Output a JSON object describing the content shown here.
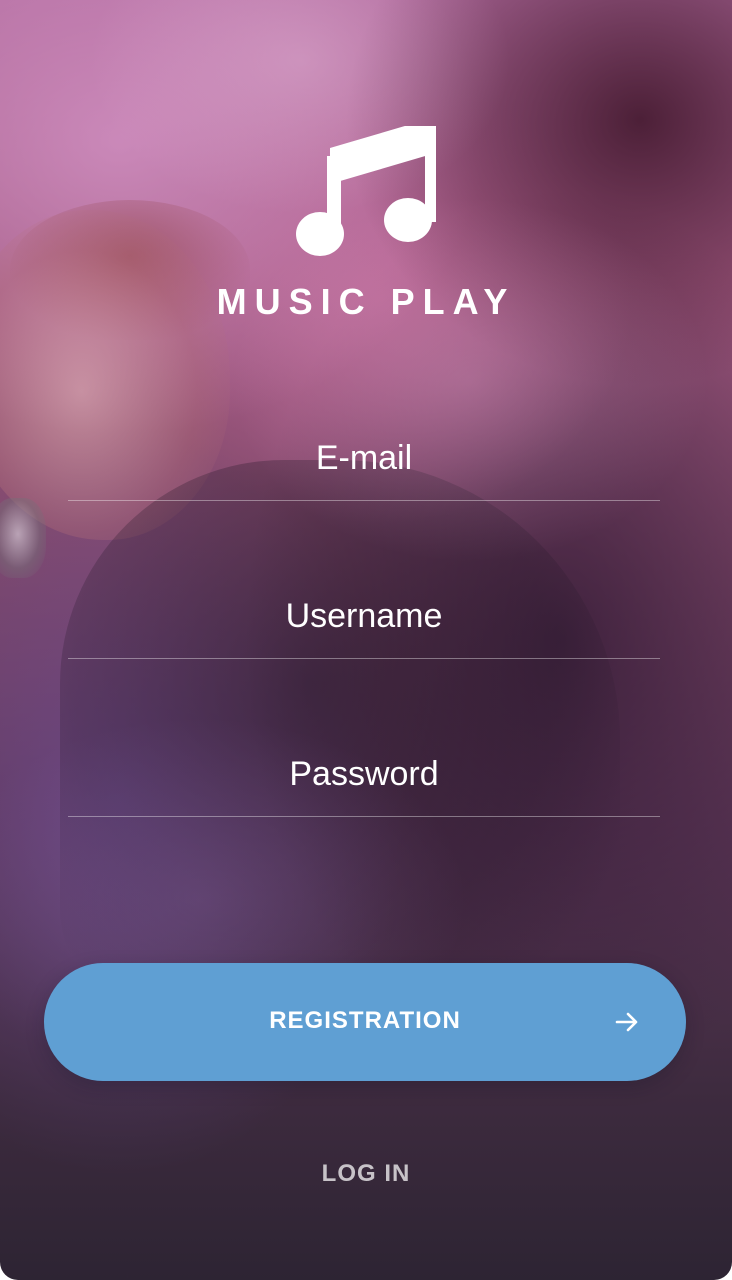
{
  "app": {
    "title": "MUSIC PLAY",
    "logo_icon": "music-note-icon"
  },
  "form": {
    "email_label": "E-mail",
    "username_label": "Username",
    "password_label": "Password"
  },
  "actions": {
    "registration_label": "REGISTRATION",
    "registration_icon": "arrow-right-icon",
    "login_label": "LOG IN"
  },
  "colors": {
    "accent": "#5f9fd3",
    "text": "#ffffff"
  }
}
